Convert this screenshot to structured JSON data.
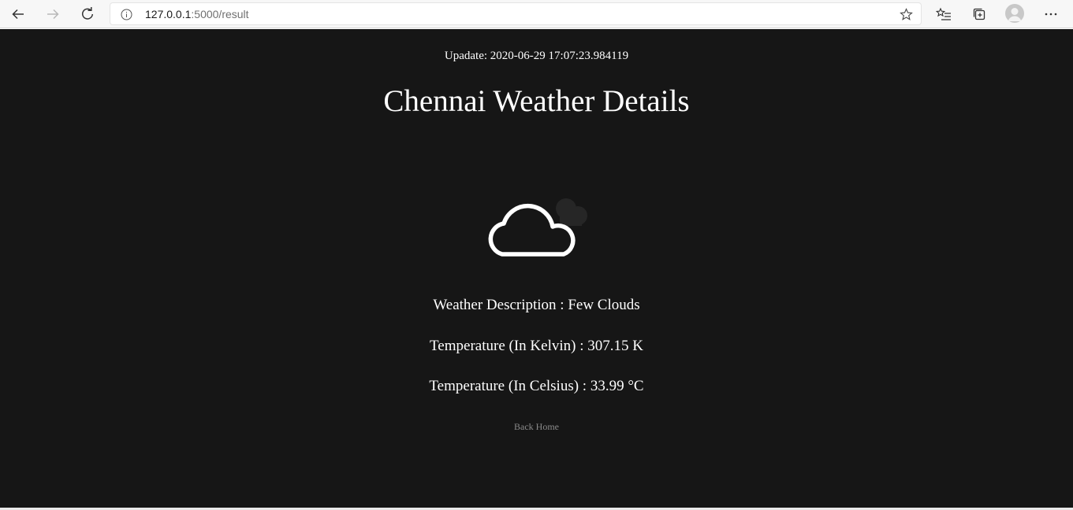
{
  "browser": {
    "url_host": "127.0.0.1",
    "url_path": ":5000/result"
  },
  "page": {
    "update_label": "Upadate:",
    "update_value": "2020-06-29 17:07:23.984119",
    "title": "Chennai Weather Details",
    "weather_icon": "cloud-icon",
    "description_line": "Weather Description : Few Clouds",
    "kelvin_line": "Temperature (In Kelvin) : 307.15 K",
    "celsius_line": "Temperature (In Celsius) : 33.99 °C",
    "back_link": "Back Home"
  },
  "colors": {
    "page_background": "#161616",
    "text": "#ffffff",
    "link": "#8a8a8a"
  }
}
